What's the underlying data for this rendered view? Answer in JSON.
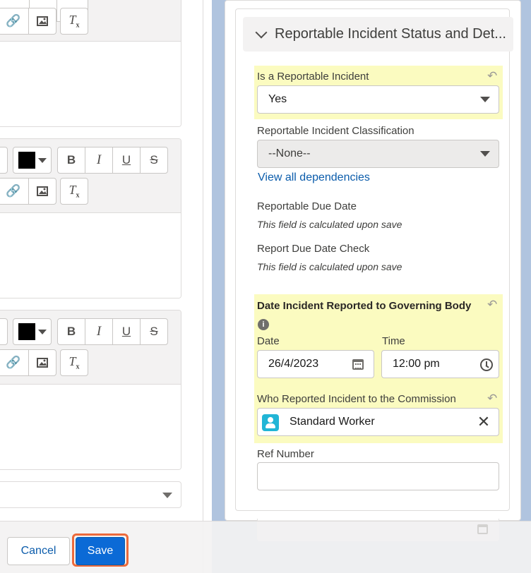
{
  "section": {
    "title": "Reportable Incident Status and Det..."
  },
  "fields": {
    "is_reportable": {
      "label": "Is a Reportable Incident",
      "value": "Yes"
    },
    "classification": {
      "label": "Reportable Incident Classification",
      "value": "--None--"
    },
    "dependencies_link": "View all dependencies",
    "reportable_due_date": {
      "label": "Reportable Due Date",
      "note": "This field is calculated upon save"
    },
    "report_due_date_check": {
      "label": "Report Due Date Check",
      "note": "This field is calculated upon save"
    },
    "date_reported": {
      "label": "Date Incident Reported to Governing Body",
      "date_label": "Date",
      "date_value": "26/4/2023",
      "time_label": "Time",
      "time_value": "12:00 pm"
    },
    "who_reported": {
      "label": "Who Reported Incident to the Commission",
      "value": "Standard Worker"
    },
    "ref_number": {
      "label": "Ref Number",
      "value": ""
    }
  },
  "footer": {
    "cancel_label": "Cancel",
    "save_label": "Save"
  },
  "colors": {
    "highlight": "#fbfbc0",
    "brand": "#0b6ad6",
    "link": "#0b5cab",
    "save_ring": "#ec6a3b",
    "page_background": "#b0c4df"
  },
  "icons": {
    "toolbar": [
      "link-icon",
      "image-icon",
      "clear-formatting-icon",
      "text-color-icon",
      "bold-icon",
      "italic-icon",
      "underline-icon",
      "strikethrough-icon"
    ],
    "fields": [
      "undo-icon",
      "info-icon",
      "calendar-icon",
      "clock-icon",
      "user-avatar-icon",
      "clear-icon",
      "chevron-down-icon"
    ]
  }
}
